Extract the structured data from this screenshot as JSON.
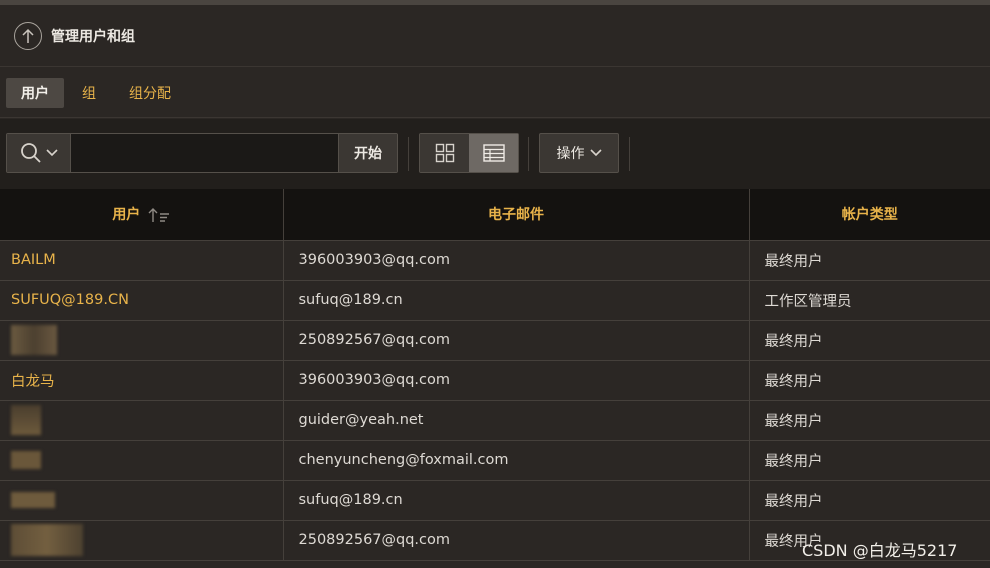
{
  "header": {
    "title": "管理用户和组",
    "back_icon": "arrow-up-circle-icon"
  },
  "tabs": [
    {
      "label": "用户",
      "active": true
    },
    {
      "label": "组",
      "active": false
    },
    {
      "label": "组分配",
      "active": false
    }
  ],
  "toolbar": {
    "search_value": "",
    "search_icon": "search-icon",
    "go_label": "开始",
    "view_modes": [
      "grid-view-icon",
      "report-view-icon"
    ],
    "active_view": "report-view-icon",
    "actions_label": "操作"
  },
  "table": {
    "columns": [
      "用户",
      "电子邮件",
      "帐户类型"
    ],
    "sort_icon": "sort-ascending-icon",
    "rows": [
      {
        "user": "BAILM",
        "email": "396003903@qq.com",
        "type": "最终用户"
      },
      {
        "user": "SUFUQ@189.CN",
        "email": "sufuq@189.cn",
        "type": "工作区管理员"
      },
      {
        "user": "",
        "email": "250892567@qq.com",
        "type": "最终用户"
      },
      {
        "user": "白龙马",
        "email": "396003903@qq.com",
        "type": "最终用户"
      },
      {
        "user": "",
        "email": "guider@yeah.net",
        "type": "最终用户"
      },
      {
        "user": "",
        "email": "chenyuncheng@foxmail.com",
        "type": "最终用户"
      },
      {
        "user": "",
        "email": "sufuq@189.cn",
        "type": "最终用户"
      },
      {
        "user": "",
        "email": "250892567@qq.com",
        "type": "最终用户"
      }
    ]
  },
  "watermark": "CSDN @白龙马5217",
  "colors": {
    "accent": "#e8b34a",
    "background": "#2b2724",
    "header_row": "#141210"
  }
}
